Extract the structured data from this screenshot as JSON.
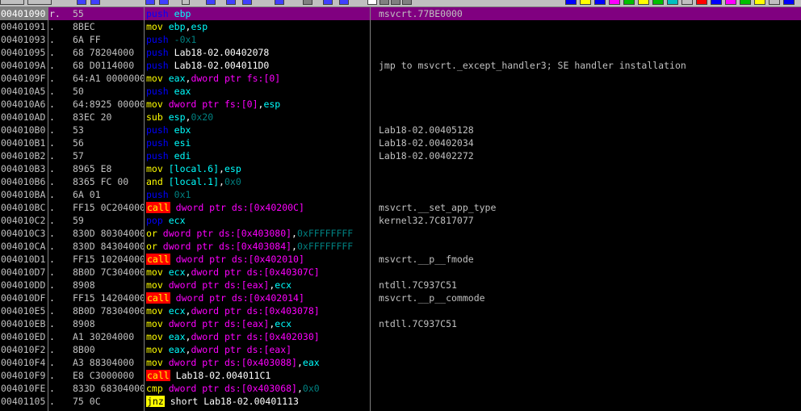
{
  "colors": {
    "push": "#0000ff",
    "mov": "#ffff00",
    "sub": "#ffff00",
    "and": "#ffff00",
    "or": "#ffff00",
    "cmp": "#ffff00",
    "call_bg": "#ff0000",
    "call_fg": "#ffff00",
    "jcc_bg": "#ffff00",
    "jcc_fg": "#000000",
    "pop": "#0000ff",
    "reg": "#00ffff",
    "mem": "#ff00ff",
    "imm": "#008080",
    "sym": "#ffffff"
  },
  "rows": [
    {
      "addr": "00401090",
      "mark": "r.",
      "hex": "55",
      "ins": [
        [
          "push",
          "push"
        ],
        [
          "sp",
          " "
        ],
        [
          "reg",
          "ebp"
        ]
      ],
      "cmt": "msvcrt.77BE0000",
      "sel": true
    },
    {
      "addr": "00401091",
      "mark": ".",
      "hex": "8BEC",
      "ins": [
        [
          "mov",
          "mov"
        ],
        [
          "sp",
          " "
        ],
        [
          "reg",
          "ebp"
        ],
        [
          "sym",
          ","
        ],
        [
          "reg",
          "esp"
        ]
      ],
      "cmt": ""
    },
    {
      "addr": "00401093",
      "mark": ".",
      "hex": "6A FF",
      "ins": [
        [
          "push",
          "push"
        ],
        [
          "sp",
          " "
        ],
        [
          "imm",
          "-0x1"
        ]
      ],
      "cmt": ""
    },
    {
      "addr": "00401095",
      "mark": ".",
      "hex": "68 78204000",
      "ins": [
        [
          "push",
          "push"
        ],
        [
          "sp",
          " "
        ],
        [
          "sym",
          "Lab18-02.00402078"
        ]
      ],
      "cmt": ""
    },
    {
      "addr": "0040109A",
      "mark": ".",
      "hex": "68 D0114000",
      "ins": [
        [
          "push",
          "push"
        ],
        [
          "sp",
          " "
        ],
        [
          "sym",
          "Lab18-02.004011D0"
        ]
      ],
      "cmt": "jmp to msvcrt._except_handler3; SE handler installation"
    },
    {
      "addr": "0040109F",
      "mark": ".",
      "hex": "64:A1 00000000",
      "ins": [
        [
          "mov",
          "mov"
        ],
        [
          "sp",
          " "
        ],
        [
          "reg",
          "eax"
        ],
        [
          "sym",
          ","
        ],
        [
          "mem",
          "dword ptr fs:[0]"
        ]
      ],
      "cmt": ""
    },
    {
      "addr": "004010A5",
      "mark": ".",
      "hex": "50",
      "ins": [
        [
          "push",
          "push"
        ],
        [
          "sp",
          " "
        ],
        [
          "reg",
          "eax"
        ]
      ],
      "cmt": ""
    },
    {
      "addr": "004010A6",
      "mark": ".",
      "hex": "64:8925 00000000",
      "ins": [
        [
          "mov",
          "mov"
        ],
        [
          "sp",
          " "
        ],
        [
          "mem",
          "dword ptr fs:[0]"
        ],
        [
          "sym",
          ","
        ],
        [
          "reg",
          "esp"
        ]
      ],
      "cmt": ""
    },
    {
      "addr": "004010AD",
      "mark": ".",
      "hex": "83EC 20",
      "ins": [
        [
          "sub",
          "sub"
        ],
        [
          "sp",
          " "
        ],
        [
          "reg",
          "esp"
        ],
        [
          "sym",
          ","
        ],
        [
          "imm",
          "0x20"
        ]
      ],
      "cmt": ""
    },
    {
      "addr": "004010B0",
      "mark": ".",
      "hex": "53",
      "ins": [
        [
          "push",
          "push"
        ],
        [
          "sp",
          " "
        ],
        [
          "reg",
          "ebx"
        ]
      ],
      "cmt": "Lab18-02.00405128"
    },
    {
      "addr": "004010B1",
      "mark": ".",
      "hex": "56",
      "ins": [
        [
          "push",
          "push"
        ],
        [
          "sp",
          " "
        ],
        [
          "reg",
          "esi"
        ]
      ],
      "cmt": "Lab18-02.00402034"
    },
    {
      "addr": "004010B2",
      "mark": ".",
      "hex": "57",
      "ins": [
        [
          "push",
          "push"
        ],
        [
          "sp",
          " "
        ],
        [
          "reg",
          "edi"
        ]
      ],
      "cmt": "Lab18-02.00402272"
    },
    {
      "addr": "004010B3",
      "mark": ".",
      "hex": "8965 E8",
      "ins": [
        [
          "mov",
          "mov"
        ],
        [
          "sp",
          " "
        ],
        [
          "reg",
          "[local.6]"
        ],
        [
          "sym",
          ","
        ],
        [
          "reg",
          "esp"
        ]
      ],
      "cmt": ""
    },
    {
      "addr": "004010B6",
      "mark": ".",
      "hex": "8365 FC 00",
      "ins": [
        [
          "and",
          "and"
        ],
        [
          "sp",
          " "
        ],
        [
          "reg",
          "[local.1]"
        ],
        [
          "sym",
          ","
        ],
        [
          "imm",
          "0x0"
        ]
      ],
      "cmt": ""
    },
    {
      "addr": "004010BA",
      "mark": ".",
      "hex": "6A 01",
      "ins": [
        [
          "push",
          "push"
        ],
        [
          "sp",
          " "
        ],
        [
          "imm",
          "0x1"
        ]
      ],
      "cmt": ""
    },
    {
      "addr": "004010BC",
      "mark": ".",
      "hex": "FF15 0C204000",
      "ins": [
        [
          "call",
          "call"
        ],
        [
          "sp",
          " "
        ],
        [
          "mem",
          "dword ptr ds:[0x40200C]"
        ]
      ],
      "cmt": "msvcrt.__set_app_type"
    },
    {
      "addr": "004010C2",
      "mark": ".",
      "hex": "59",
      "ins": [
        [
          "pop",
          "pop"
        ],
        [
          "sp",
          " "
        ],
        [
          "reg",
          "ecx"
        ]
      ],
      "cmt": "kernel32.7C817077"
    },
    {
      "addr": "004010C3",
      "mark": ".",
      "hex": "830D 80304000 FF",
      "ins": [
        [
          "or",
          "or"
        ],
        [
          "sp",
          " "
        ],
        [
          "mem",
          "dword ptr ds:[0x403080]"
        ],
        [
          "sym",
          ","
        ],
        [
          "imm",
          "0xFFFFFFFF"
        ]
      ],
      "cmt": ""
    },
    {
      "addr": "004010CA",
      "mark": ".",
      "hex": "830D 84304000 FF",
      "ins": [
        [
          "or",
          "or"
        ],
        [
          "sp",
          " "
        ],
        [
          "mem",
          "dword ptr ds:[0x403084]"
        ],
        [
          "sym",
          ","
        ],
        [
          "imm",
          "0xFFFFFFFF"
        ]
      ],
      "cmt": ""
    },
    {
      "addr": "004010D1",
      "mark": ".",
      "hex": "FF15 10204000",
      "ins": [
        [
          "call",
          "call"
        ],
        [
          "sp",
          " "
        ],
        [
          "mem",
          "dword ptr ds:[0x402010]"
        ]
      ],
      "cmt": "msvcrt.__p__fmode"
    },
    {
      "addr": "004010D7",
      "mark": ".",
      "hex": "8B0D 7C304000",
      "ins": [
        [
          "mov",
          "mov"
        ],
        [
          "sp",
          " "
        ],
        [
          "reg",
          "ecx"
        ],
        [
          "sym",
          ","
        ],
        [
          "mem",
          "dword ptr ds:[0x40307C]"
        ]
      ],
      "cmt": ""
    },
    {
      "addr": "004010DD",
      "mark": ".",
      "hex": "8908",
      "ins": [
        [
          "mov",
          "mov"
        ],
        [
          "sp",
          " "
        ],
        [
          "mem",
          "dword ptr ds:[eax]"
        ],
        [
          "sym",
          ","
        ],
        [
          "reg",
          "ecx"
        ]
      ],
      "cmt": "ntdll.7C937C51"
    },
    {
      "addr": "004010DF",
      "mark": ".",
      "hex": "FF15 14204000",
      "ins": [
        [
          "call",
          "call"
        ],
        [
          "sp",
          " "
        ],
        [
          "mem",
          "dword ptr ds:[0x402014]"
        ]
      ],
      "cmt": "msvcrt.__p__commode"
    },
    {
      "addr": "004010E5",
      "mark": ".",
      "hex": "8B0D 78304000",
      "ins": [
        [
          "mov",
          "mov"
        ],
        [
          "sp",
          " "
        ],
        [
          "reg",
          "ecx"
        ],
        [
          "sym",
          ","
        ],
        [
          "mem",
          "dword ptr ds:[0x403078]"
        ]
      ],
      "cmt": ""
    },
    {
      "addr": "004010EB",
      "mark": ".",
      "hex": "8908",
      "ins": [
        [
          "mov",
          "mov"
        ],
        [
          "sp",
          " "
        ],
        [
          "mem",
          "dword ptr ds:[eax]"
        ],
        [
          "sym",
          ","
        ],
        [
          "reg",
          "ecx"
        ]
      ],
      "cmt": "ntdll.7C937C51"
    },
    {
      "addr": "004010ED",
      "mark": ".",
      "hex": "A1 30204000",
      "ins": [
        [
          "mov",
          "mov"
        ],
        [
          "sp",
          " "
        ],
        [
          "reg",
          "eax"
        ],
        [
          "sym",
          ","
        ],
        [
          "mem",
          "dword ptr ds:[0x402030]"
        ]
      ],
      "cmt": ""
    },
    {
      "addr": "004010F2",
      "mark": ".",
      "hex": "8B00",
      "ins": [
        [
          "mov",
          "mov"
        ],
        [
          "sp",
          " "
        ],
        [
          "reg",
          "eax"
        ],
        [
          "sym",
          ","
        ],
        [
          "mem",
          "dword ptr ds:[eax]"
        ]
      ],
      "cmt": ""
    },
    {
      "addr": "004010F4",
      "mark": ".",
      "hex": "A3 88304000",
      "ins": [
        [
          "mov",
          "mov"
        ],
        [
          "sp",
          " "
        ],
        [
          "mem",
          "dword ptr ds:[0x403088]"
        ],
        [
          "sym",
          ","
        ],
        [
          "reg",
          "eax"
        ]
      ],
      "cmt": ""
    },
    {
      "addr": "004010F9",
      "mark": ".",
      "hex": "E8 C3000000",
      "ins": [
        [
          "call",
          "call"
        ],
        [
          "sp",
          " "
        ],
        [
          "sym",
          "Lab18-02.004011C1"
        ]
      ],
      "cmt": ""
    },
    {
      "addr": "004010FE",
      "mark": ".",
      "hex": "833D 68304000 00",
      "ins": [
        [
          "cmp",
          "cmp"
        ],
        [
          "sp",
          " "
        ],
        [
          "mem",
          "dword ptr ds:[0x403068]"
        ],
        [
          "sym",
          ","
        ],
        [
          "imm",
          "0x0"
        ]
      ],
      "cmt": ""
    },
    {
      "addr": "00401105",
      "mark": ".",
      "hex": "75 0C",
      "ins": [
        [
          "jcc",
          "jnz"
        ],
        [
          "sp",
          " "
        ],
        [
          "sym",
          "short Lab18-02.00401113"
        ]
      ],
      "cmt": ""
    }
  ]
}
